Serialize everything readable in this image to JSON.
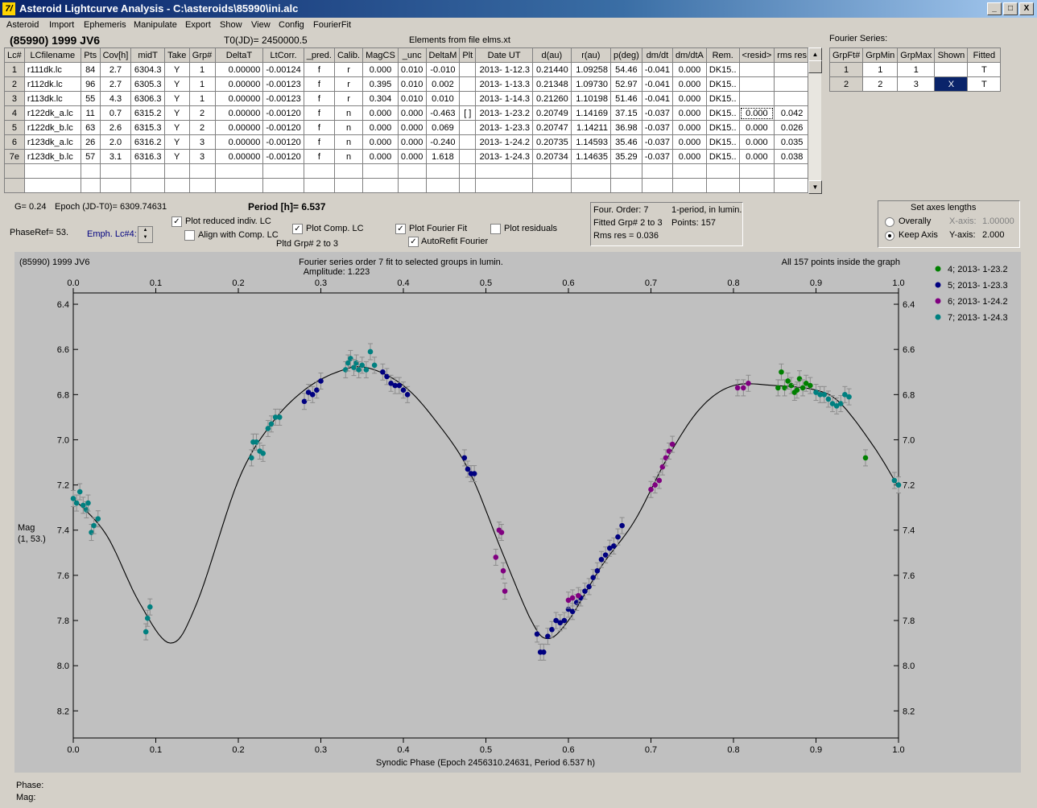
{
  "window": {
    "title": "Asteroid Lightcurve Analysis - C:\\asteroids\\85990\\ini.alc",
    "app_icon_glyph": "7/",
    "buttons": [
      "_",
      "□",
      "X"
    ]
  },
  "menu": [
    "Asteroid",
    "Import",
    "Ephemeris",
    "Manipulate",
    "Export",
    "Show",
    "View",
    "Config",
    "FourierFit"
  ],
  "header": {
    "object": "(85990) 1999 JV6",
    "t0": "T0(JD)= 2450000.5",
    "elements": "Elements from file elms.xt"
  },
  "lc_table": {
    "columns": [
      "Lc#",
      "LCfilename",
      "Pts",
      "Cov[h]",
      "midT",
      "Take",
      "Grp#",
      "DeltaT",
      "LtCorr.",
      "_pred.",
      "Calib.",
      "MagCS",
      "_unc",
      "DeltaM",
      "Plt",
      "Date UT",
      "d(au)",
      "r(au)",
      "p(deg)",
      "dm/dt",
      "dm/dtA",
      "Rem.",
      "<resid>",
      "rms res"
    ],
    "rows": [
      [
        "1",
        "r111dk.lc",
        "84",
        "2.7",
        "6304.3",
        "Y",
        "1",
        "0.00000",
        "-0.00124",
        "f",
        "r",
        "0.000",
        "0.010",
        "-0.010",
        "",
        "2013- 1-12.3",
        "0.21440",
        "1.09258",
        "54.46",
        "-0.041",
        "0.000",
        "DK15..",
        "",
        ""
      ],
      [
        "2",
        "r112dk.lc",
        "96",
        "2.7",
        "6305.3",
        "Y",
        "1",
        "0.00000",
        "-0.00123",
        "f",
        "r",
        "0.395",
        "0.010",
        "0.002",
        "",
        "2013- 1-13.3",
        "0.21348",
        "1.09730",
        "52.97",
        "-0.041",
        "0.000",
        "DK15..",
        "",
        ""
      ],
      [
        "3",
        "r113dk.lc",
        "55",
        "4.3",
        "6306.3",
        "Y",
        "1",
        "0.00000",
        "-0.00123",
        "f",
        "r",
        "0.304",
        "0.010",
        "0.010",
        "",
        "2013- 1-14.3",
        "0.21260",
        "1.10198",
        "51.46",
        "-0.041",
        "0.000",
        "DK15..",
        "",
        ""
      ],
      [
        "4",
        "r122dk_a.lc",
        "11",
        "0.7",
        "6315.2",
        "Y",
        "2",
        "0.00000",
        "-0.00120",
        "f",
        "n",
        "0.000",
        "0.000",
        "-0.463",
        "[ ]",
        "2013- 1-23.2",
        "0.20749",
        "1.14169",
        "37.15",
        "-0.037",
        "0.000",
        "DK15..",
        "0.000",
        "0.042"
      ],
      [
        "5",
        "r122dk_b.lc",
        "63",
        "2.6",
        "6315.3",
        "Y",
        "2",
        "0.00000",
        "-0.00120",
        "f",
        "n",
        "0.000",
        "0.000",
        "0.069",
        "",
        "2013- 1-23.3",
        "0.20747",
        "1.14211",
        "36.98",
        "-0.037",
        "0.000",
        "DK15..",
        "0.000",
        "0.026"
      ],
      [
        "6",
        "r123dk_a.lc",
        "26",
        "2.0",
        "6316.2",
        "Y",
        "3",
        "0.00000",
        "-0.00120",
        "f",
        "n",
        "0.000",
        "0.000",
        "-0.240",
        "",
        "2013- 1-24.2",
        "0.20735",
        "1.14593",
        "35.46",
        "-0.037",
        "0.000",
        "DK15..",
        "0.000",
        "0.035"
      ],
      [
        "7e",
        "r123dk_b.lc",
        "57",
        "3.1",
        "6316.3",
        "Y",
        "3",
        "0.00000",
        "-0.00120",
        "f",
        "n",
        "0.000",
        "0.000",
        "1.618",
        "",
        "2013- 1-24.3",
        "0.20734",
        "1.14635",
        "35.29",
        "-0.037",
        "0.000",
        "DK15..",
        "0.000",
        "0.038"
      ],
      [
        "",
        "",
        "",
        "",
        "",
        "",
        "",
        "",
        "",
        "",
        "",
        "",
        "",
        "",
        "",
        "",
        "",
        "",
        "",
        "",
        "",
        "",
        "",
        ""
      ],
      [
        "",
        "",
        "",
        "",
        "",
        "",
        "",
        "",
        "",
        "",
        "",
        "",
        "",
        "",
        "",
        "",
        "",
        "",
        "",
        "",
        "",
        "",
        "",
        ""
      ]
    ]
  },
  "fourier_series": {
    "label": "Fourier Series:",
    "columns": [
      "GrpFt#",
      "GrpMin",
      "GrpMax",
      "Shown",
      "Fitted"
    ],
    "rows": [
      [
        "1",
        "1",
        "1",
        "",
        "T"
      ],
      [
        "2",
        "2",
        "3",
        "X",
        "T"
      ]
    ]
  },
  "controls": {
    "g": "G= 0.24",
    "epoch": "Epoch (JD-T0)= 6309.74631",
    "period": "Period [h]= 6.537",
    "phaseref": "PhaseRef= 53.",
    "emph": "Emph. Lc#4:",
    "plot_reduced": "Plot reduced indiv. LC",
    "align_comp": "Align with Comp. LC",
    "plot_comp": "Plot Comp. LC",
    "pltd_grp": "Pltd Grp#  2   to    3",
    "plot_fourier": "Plot Fourier Fit",
    "autorefit": "AutoRefit Fourier",
    "plot_residuals": "Plot residuals"
  },
  "info": {
    "four_order": "Four. Order:  7",
    "one_period": "1-period, in lumin.",
    "fitted": "Fitted Grp# 2 to 3",
    "points": "Points: 157",
    "rms": "Rms res     = 0.036"
  },
  "axes": {
    "title": "Set axes lengths",
    "overally": "Overally",
    "keep_axis": "Keep Axis",
    "x_label": "X-axis:",
    "x_value": "1.00000",
    "y_label": "Y-axis:",
    "y_value": "2.000"
  },
  "footer": {
    "phase": "Phase:",
    "mag": "Mag:"
  },
  "chart_data": {
    "type": "scatter",
    "top_left": "(85990) 1999 JV6",
    "title": "Fourier series order 7 fit to selected groups in lumin.",
    "subtitle": "Amplitude: 1.223",
    "top_right": "All 157 points inside the graph",
    "xlabel": "Synodic Phase (Epoch 2456310.24631, Period 6.537 h)",
    "ylabel": [
      "Mag",
      "(1, 53.)"
    ],
    "xlim": [
      0.0,
      1.0
    ],
    "ylim": [
      6.35,
      8.32
    ],
    "y_inverted": true,
    "x_ticks": [
      "0.0",
      "0.1",
      "0.2",
      "0.3",
      "0.4",
      "0.5",
      "0.6",
      "0.7",
      "0.8",
      "0.9",
      "1.0"
    ],
    "y_ticks": [
      "6.4",
      "6.6",
      "6.8",
      "7.0",
      "7.2",
      "7.4",
      "7.6",
      "7.8",
      "8.0",
      "8.2"
    ],
    "legend_position": "top-right",
    "series": [
      {
        "name": "4; 2013- 1-23.2",
        "color": "#008000",
        "points": [
          [
            0.854,
            6.77
          ],
          [
            0.858,
            6.7
          ],
          [
            0.862,
            6.77
          ],
          [
            0.866,
            6.74
          ],
          [
            0.87,
            6.76
          ],
          [
            0.874,
            6.79
          ],
          [
            0.877,
            6.78
          ],
          [
            0.88,
            6.73
          ],
          [
            0.884,
            6.77
          ],
          [
            0.888,
            6.75
          ],
          [
            0.893,
            6.76
          ],
          [
            0.96,
            7.08
          ]
        ]
      },
      {
        "name": "5; 2013- 1-23.3",
        "color": "#000080",
        "points": [
          [
            0.28,
            6.83
          ],
          [
            0.285,
            6.79
          ],
          [
            0.29,
            6.8
          ],
          [
            0.295,
            6.78
          ],
          [
            0.3,
            6.74
          ],
          [
            0.375,
            6.7
          ],
          [
            0.38,
            6.72
          ],
          [
            0.385,
            6.75
          ],
          [
            0.39,
            6.76
          ],
          [
            0.395,
            6.76
          ],
          [
            0.4,
            6.78
          ],
          [
            0.405,
            6.8
          ],
          [
            0.474,
            7.08
          ],
          [
            0.478,
            7.13
          ],
          [
            0.482,
            7.15
          ],
          [
            0.486,
            7.15
          ],
          [
            0.562,
            7.86
          ],
          [
            0.566,
            7.94
          ],
          [
            0.57,
            7.94
          ],
          [
            0.575,
            7.87
          ],
          [
            0.58,
            7.84
          ],
          [
            0.585,
            7.8
          ],
          [
            0.59,
            7.81
          ],
          [
            0.595,
            7.8
          ],
          [
            0.6,
            7.75
          ],
          [
            0.605,
            7.76
          ],
          [
            0.61,
            7.72
          ],
          [
            0.615,
            7.7
          ],
          [
            0.62,
            7.67
          ],
          [
            0.625,
            7.65
          ],
          [
            0.63,
            7.61
          ],
          [
            0.635,
            7.58
          ],
          [
            0.64,
            7.53
          ],
          [
            0.645,
            7.51
          ],
          [
            0.65,
            7.48
          ],
          [
            0.655,
            7.47
          ],
          [
            0.66,
            7.43
          ],
          [
            0.665,
            7.38
          ]
        ]
      },
      {
        "name": "6; 2013- 1-24.2",
        "color": "#800080",
        "points": [
          [
            0.512,
            7.52
          ],
          [
            0.516,
            7.4
          ],
          [
            0.519,
            7.41
          ],
          [
            0.521,
            7.58
          ],
          [
            0.523,
            7.67
          ],
          [
            0.6,
            7.71
          ],
          [
            0.605,
            7.7
          ],
          [
            0.612,
            7.69
          ],
          [
            0.7,
            7.22
          ],
          [
            0.705,
            7.2
          ],
          [
            0.71,
            7.18
          ],
          [
            0.714,
            7.12
          ],
          [
            0.718,
            7.08
          ],
          [
            0.722,
            7.05
          ],
          [
            0.726,
            7.02
          ],
          [
            0.805,
            6.77
          ],
          [
            0.812,
            6.77
          ],
          [
            0.818,
            6.75
          ]
        ]
      },
      {
        "name": "7; 2013- 1-24.3",
        "color": "#008080",
        "points": [
          [
            0.0,
            7.26
          ],
          [
            0.004,
            7.28
          ],
          [
            0.008,
            7.23
          ],
          [
            0.012,
            7.29
          ],
          [
            0.016,
            7.31
          ],
          [
            0.018,
            7.28
          ],
          [
            0.022,
            7.41
          ],
          [
            0.025,
            7.38
          ],
          [
            0.03,
            7.35
          ],
          [
            0.088,
            7.85
          ],
          [
            0.09,
            7.79
          ],
          [
            0.093,
            7.74
          ],
          [
            0.216,
            7.08
          ],
          [
            0.218,
            7.01
          ],
          [
            0.222,
            7.01
          ],
          [
            0.226,
            7.05
          ],
          [
            0.23,
            7.06
          ],
          [
            0.236,
            6.95
          ],
          [
            0.24,
            6.93
          ],
          [
            0.245,
            6.9
          ],
          [
            0.25,
            6.9
          ],
          [
            0.33,
            6.69
          ],
          [
            0.333,
            6.66
          ],
          [
            0.336,
            6.64
          ],
          [
            0.34,
            6.68
          ],
          [
            0.343,
            6.66
          ],
          [
            0.346,
            6.69
          ],
          [
            0.35,
            6.67
          ],
          [
            0.355,
            6.69
          ],
          [
            0.36,
            6.61
          ],
          [
            0.365,
            6.67
          ],
          [
            0.9,
            6.79
          ],
          [
            0.905,
            6.8
          ],
          [
            0.91,
            6.8
          ],
          [
            0.915,
            6.82
          ],
          [
            0.92,
            6.84
          ],
          [
            0.925,
            6.85
          ],
          [
            0.93,
            6.84
          ],
          [
            0.935,
            6.8
          ],
          [
            0.94,
            6.81
          ],
          [
            1.0,
            7.2
          ],
          [
            0.995,
            7.18
          ]
        ]
      }
    ]
  }
}
